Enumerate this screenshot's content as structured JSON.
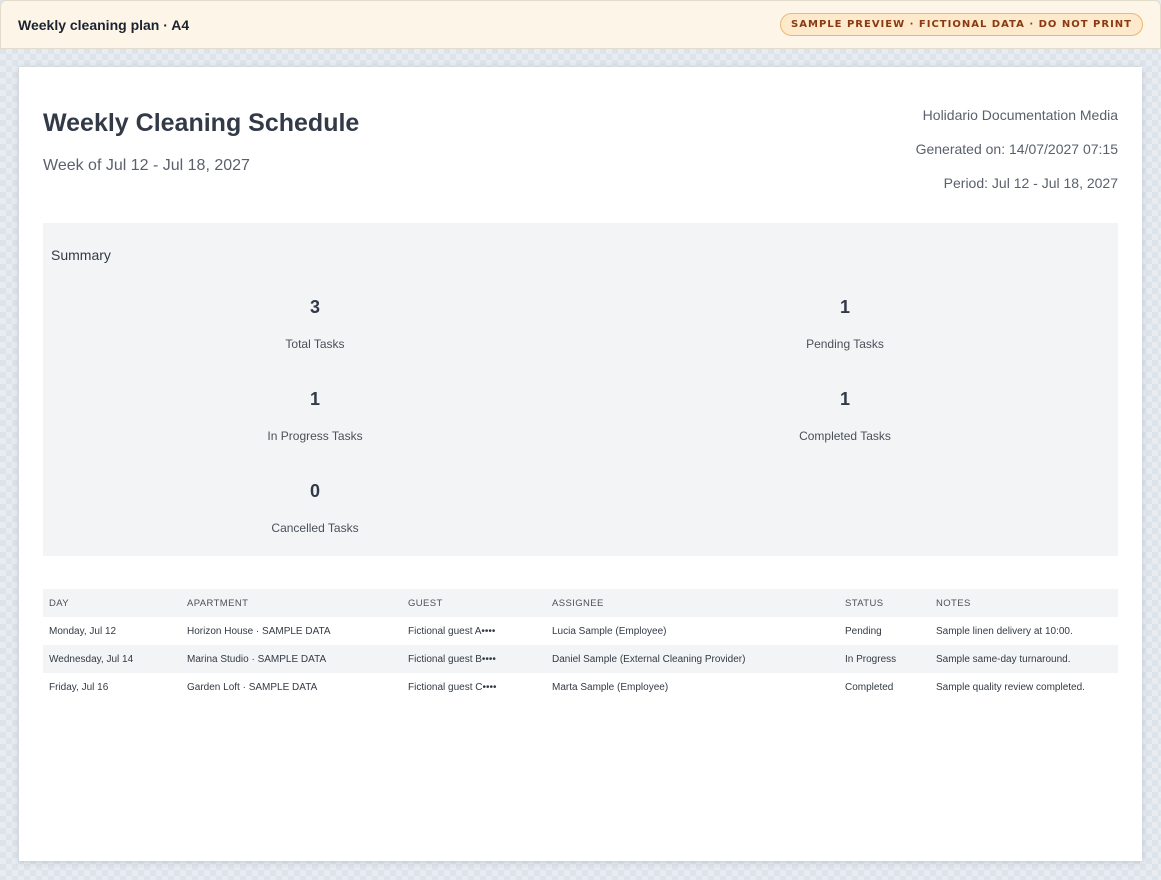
{
  "window": {
    "title": "Weekly cleaning plan · A4",
    "badge": "SAMPLE PREVIEW · FICTIONAL DATA · DO NOT PRINT"
  },
  "document": {
    "title": "Weekly Cleaning Schedule",
    "subtitle": "Week of Jul 12 - Jul 18, 2027",
    "company": "Holidario Documentation Media",
    "generated": "Generated on: 14/07/2027 07:15",
    "period": "Period: Jul 12 - Jul 18, 2027"
  },
  "summary": {
    "label": "Summary",
    "stats": [
      {
        "value": "3",
        "label": "Total Tasks"
      },
      {
        "value": "1",
        "label": "Pending Tasks"
      },
      {
        "value": "1",
        "label": "In Progress Tasks"
      },
      {
        "value": "1",
        "label": "Completed Tasks"
      },
      {
        "value": "0",
        "label": "Cancelled Tasks"
      }
    ]
  },
  "table": {
    "columns": [
      "DAY",
      "APARTMENT",
      "GUEST",
      "ASSIGNEE",
      "STATUS",
      "NOTES"
    ],
    "rows": [
      [
        "Monday, Jul 12",
        "Horizon House · SAMPLE DATA",
        "Fictional guest A••••",
        "Lucia Sample (Employee)",
        "Pending",
        "Sample linen delivery at 10:00."
      ],
      [
        "Wednesday, Jul 14",
        "Marina Studio · SAMPLE DATA",
        "Fictional guest B••••",
        "Daniel Sample (External Cleaning Provider)",
        "In Progress",
        "Sample same-day turnaround."
      ],
      [
        "Friday, Jul 16",
        "Garden Loft · SAMPLE DATA",
        "Fictional guest C••••",
        "Marta Sample (Employee)",
        "Completed",
        "Sample quality review completed."
      ]
    ]
  }
}
